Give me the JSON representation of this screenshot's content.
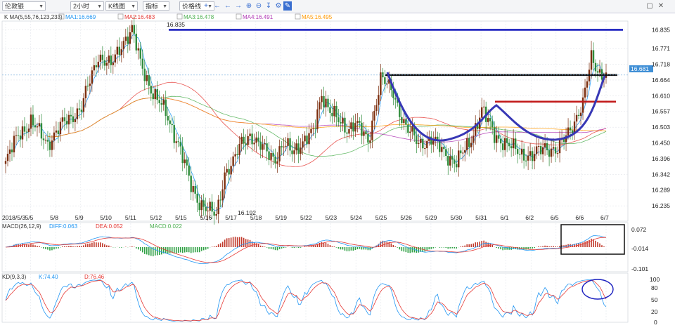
{
  "toolbar": {
    "symbol": "伦敦银",
    "period": "2小时",
    "chart_type": "K线图",
    "indicator": "指标",
    "price_line": "价格线",
    "colors": {
      "accent": "#3a6fd0"
    }
  },
  "main": {
    "legend_k": "K MA(5,55,76,123,233)",
    "ma": [
      {
        "name": "MA1:16.669",
        "color": "#2196f3"
      },
      {
        "name": "MA2:16.483",
        "color": "#e53935"
      },
      {
        "name": "MA3:16.478",
        "color": "#4caf50"
      },
      {
        "name": "MA4:16.491",
        "color": "#b03ab5"
      },
      {
        "name": "MA5:16.495",
        "color": "#ff9800"
      }
    ],
    "high_label": "16.835",
    "low_label": "16.192",
    "price_tag": "16.681"
  },
  "macd": {
    "title": "MACD(26,12,9)",
    "diff": "DIFF:0.063",
    "dea": "DEA:0.052",
    "macd": "MACD:0.022",
    "ticks": [
      "0.072",
      "-0.014",
      "-0.101"
    ]
  },
  "kd": {
    "title": "KD(9,3,3)",
    "k": "K:74.40",
    "d": "D:76.46",
    "ticks": [
      "100",
      "80",
      "50",
      "20",
      "0"
    ]
  },
  "chart_data": {
    "type": "candlestick",
    "y_ticks": [
      16.835,
      16.771,
      16.718,
      16.664,
      16.61,
      16.557,
      16.503,
      16.45,
      16.396,
      16.342,
      16.289,
      16.235
    ],
    "ylim": [
      16.19,
      16.86
    ],
    "x_labels": [
      "2018/5/3",
      "5/5",
      "5/8",
      "5/9",
      "5/10",
      "5/11",
      "5/12",
      "5/15",
      "5/16",
      "5/17",
      "5/18",
      "5/19",
      "5/22",
      "5/23",
      "5/24",
      "5/25",
      "5/26",
      "5/29",
      "5/30",
      "5/31",
      "6/1",
      "6/2",
      "6/5",
      "6/6",
      "6/7"
    ],
    "anchors": [
      [
        0,
        16.38
      ],
      [
        6,
        16.48
      ],
      [
        12,
        16.52
      ],
      [
        20,
        16.45
      ],
      [
        28,
        16.52
      ],
      [
        36,
        16.57
      ],
      [
        44,
        16.75
      ],
      [
        50,
        16.71
      ],
      [
        56,
        16.8
      ],
      [
        60,
        16.835
      ],
      [
        64,
        16.72
      ],
      [
        70,
        16.62
      ],
      [
        76,
        16.55
      ],
      [
        82,
        16.45
      ],
      [
        88,
        16.3
      ],
      [
        92,
        16.25
      ],
      [
        96,
        16.22
      ],
      [
        100,
        16.2
      ],
      [
        104,
        16.35
      ],
      [
        108,
        16.38
      ],
      [
        112,
        16.45
      ],
      [
        116,
        16.48
      ],
      [
        120,
        16.44
      ],
      [
        124,
        16.42
      ],
      [
        128,
        16.4
      ],
      [
        132,
        16.44
      ],
      [
        136,
        16.42
      ],
      [
        140,
        16.45
      ],
      [
        146,
        16.48
      ],
      [
        150,
        16.62
      ],
      [
        154,
        16.56
      ],
      [
        158,
        16.52
      ],
      [
        162,
        16.5
      ],
      [
        166,
        16.52
      ],
      [
        172,
        16.45
      ],
      [
        178,
        16.67
      ],
      [
        184,
        16.62
      ],
      [
        190,
        16.5
      ],
      [
        196,
        16.45
      ],
      [
        202,
        16.46
      ],
      [
        208,
        16.42
      ],
      [
        214,
        16.38
      ],
      [
        220,
        16.45
      ],
      [
        226,
        16.56
      ],
      [
        232,
        16.48
      ],
      [
        238,
        16.44
      ],
      [
        244,
        16.42
      ],
      [
        250,
        16.4
      ],
      [
        256,
        16.44
      ],
      [
        262,
        16.42
      ],
      [
        268,
        16.5
      ],
      [
        274,
        16.58
      ],
      [
        278,
        16.74
      ],
      [
        282,
        16.69
      ],
      [
        285,
        16.681
      ]
    ],
    "levels": [
      {
        "name": "high",
        "value": 16.835,
        "color": "#1a1fbf"
      },
      {
        "name": "neckline",
        "value": 16.681,
        "color": "#111111"
      },
      {
        "name": "handle",
        "value": 16.59,
        "color": "#c21b1b"
      }
    ]
  }
}
